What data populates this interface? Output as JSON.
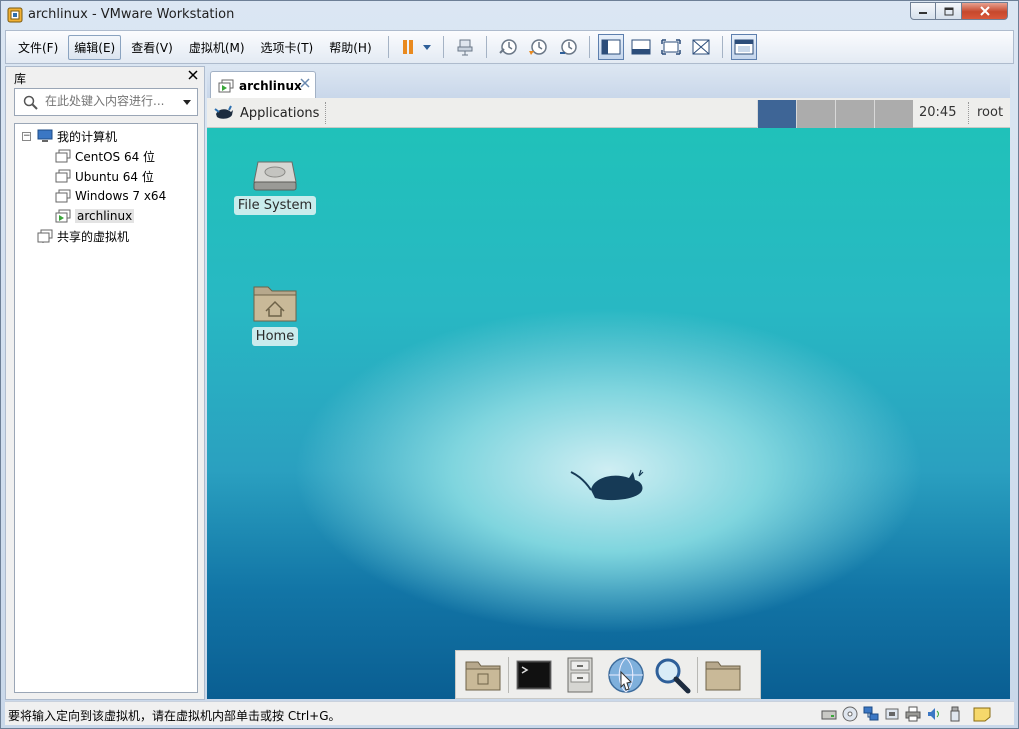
{
  "window": {
    "title": "archlinux - VMware Workstation"
  },
  "menu": {
    "file": "文件(F)",
    "edit": "编辑(E)",
    "view": "查看(V)",
    "vm": "虚拟机(M)",
    "tabs": "选项卡(T)",
    "help": "帮助(H)"
  },
  "library": {
    "title": "库",
    "search_placeholder": "在此处键入内容进行...",
    "tree": {
      "root": "我的计算机",
      "vms": [
        "CentOS 64 位",
        "Ubuntu 64 位",
        "Windows 7 x64",
        "archlinux"
      ],
      "shared": "共享的虚拟机"
    }
  },
  "tab": {
    "label": "archlinux"
  },
  "guest": {
    "panel": {
      "applications": "Applications",
      "clock": "20:45",
      "user": "root",
      "workspaces": 4,
      "active_workspace": 1
    },
    "desktop_icons": [
      "File System",
      "Home"
    ]
  },
  "status": {
    "text": "要将输入定向到该虚拟机，请在虚拟机内部单击或按 Ctrl+G。"
  },
  "colors": {
    "accent": "#3e6596",
    "close": "#c6482d"
  }
}
